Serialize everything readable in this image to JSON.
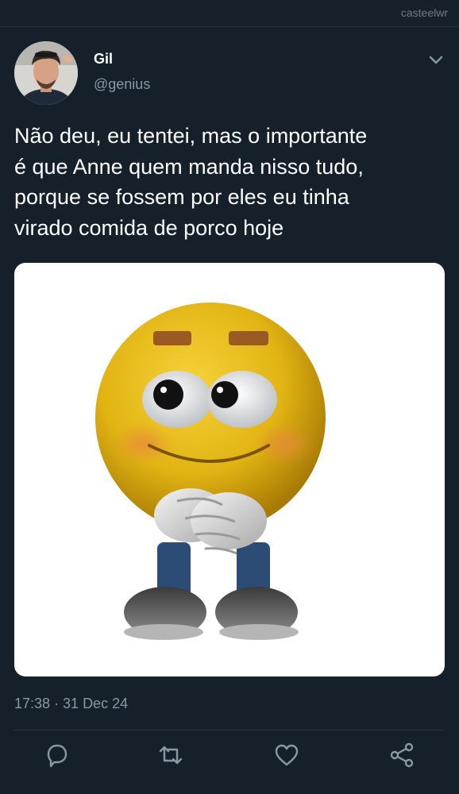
{
  "watermark": "casteelwr",
  "tweet": {
    "author_name": "Gil",
    "author_handle": "@genius",
    "text": "Não deu, eu tentei, mas o importante\né que Anne quem manda nisso tudo,\nporque se fossem por eles eu tinha\nvirado comida de porco hoje",
    "timestamp": "17:38 · 31 Dec 24",
    "media": {
      "type": "image",
      "subject": "shy-emoji-character",
      "background": "#ffffff"
    }
  },
  "actions": [
    {
      "name": "reply",
      "icon": "reply-icon"
    },
    {
      "name": "retweet",
      "icon": "retweet-icon"
    },
    {
      "name": "like",
      "icon": "heart-icon"
    },
    {
      "name": "share",
      "icon": "share-icon"
    }
  ],
  "colors": {
    "background": "#15202b",
    "text": "#ffffff",
    "secondary_text": "#8899a6",
    "divider": "#2b3640"
  }
}
